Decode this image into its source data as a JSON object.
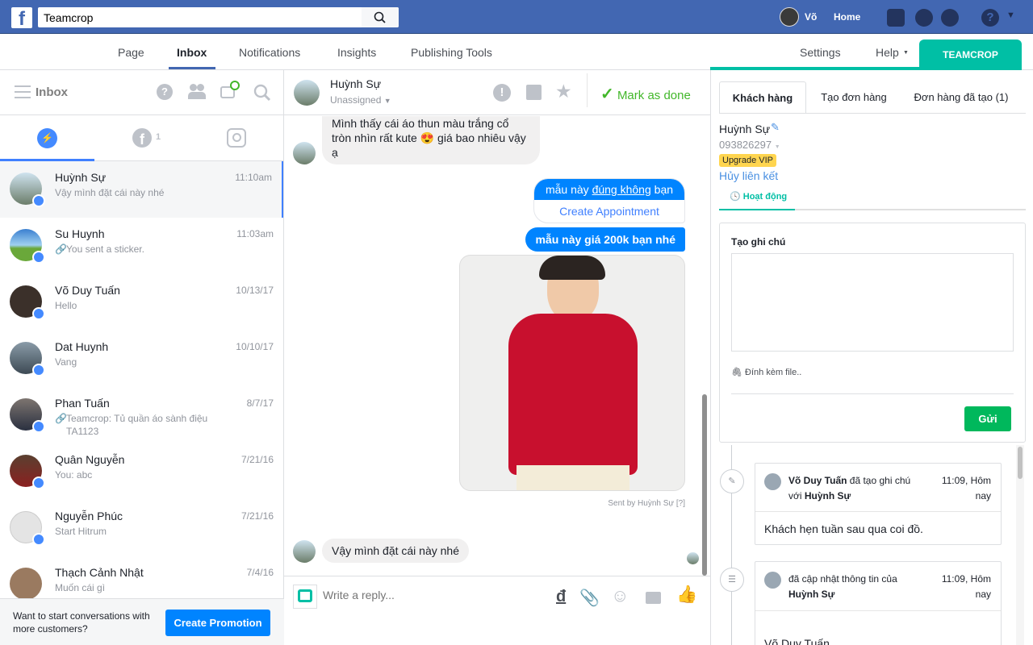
{
  "topbar": {
    "logo": "f",
    "search_value": "Teamcrop",
    "user_name": "Võ",
    "home": "Home"
  },
  "nav": {
    "items": [
      "Page",
      "Inbox",
      "Notifications",
      "Insights",
      "Publishing Tools"
    ],
    "active": "Inbox",
    "settings": "Settings",
    "help": "Help",
    "teamcrop": "TEAMCROP"
  },
  "inbox": {
    "title": "Inbox",
    "facebook_count": "1",
    "conversations": [
      {
        "name": "Huỳnh Sự",
        "time": "11:10am",
        "preview": "Vậy mình đặt cái này nhé",
        "selected": true
      },
      {
        "name": "Su Huynh",
        "time": "11:03am",
        "preview": "You sent a sticker.",
        "attachment": true
      },
      {
        "name": "Võ Duy Tuấn",
        "time": "10/13/17",
        "preview": "Hello"
      },
      {
        "name": "Dat Huynh",
        "time": "10/10/17",
        "preview": "Vang"
      },
      {
        "name": "Phan Tuấn",
        "time": "8/7/17",
        "preview": "Teamcrop: Tủ quần áo sành điệu TA1123",
        "attachment": true
      },
      {
        "name": "Quân Nguyễn",
        "time": "7/21/16",
        "preview": "You: abc"
      },
      {
        "name": "Nguyễn Phúc",
        "time": "7/21/16",
        "preview": "Start Hitrum"
      },
      {
        "name": "Thạch Cảnh Nhật",
        "time": "7/4/16",
        "preview": "Muốn cái gì"
      }
    ],
    "promo_text": "Want to start conversations with more customers?",
    "promo_button": "Create Promotion"
  },
  "chat": {
    "name": "Huỳnh Sự",
    "assignee": "Unassigned",
    "mark_done": "Mark as done",
    "messages": {
      "m1": "Mình thấy cái áo thun màu trắng cổ tròn nhìn rất kute 😍 giá bao nhiêu vậy ạ",
      "m2_pre": "mẫu này ",
      "m2_link": "đúng không",
      "m2_post": " bạn",
      "m2_action": "Create Appointment",
      "m3": "mẫu này giá 200k bạn nhé",
      "sent_by": "Sent by Huỳnh Sự",
      "sent_help": "[?]",
      "m4": "Vậy mình đặt cái này nhé"
    },
    "reply_placeholder": "Write a reply..."
  },
  "customer": {
    "tabs": [
      "Khách hàng",
      "Tạo đơn hàng",
      "Đơn hàng đã tạo (1)"
    ],
    "name": "Huỳnh Sự",
    "phone": "093826297",
    "vip": "Upgrade VIP",
    "unlink": "Hủy liên kết",
    "activity_tab": "Hoạt động",
    "note_title": "Tạo ghi chú",
    "attach": "Đính kèm file..",
    "send": "Gửi",
    "timeline": [
      {
        "actor": "Võ Duy Tuấn",
        "action": " đã tạo ghi chú với ",
        "target": "Huỳnh Sự",
        "time": "11:09, Hôm nay",
        "body": "Khách hẹn tuần sau qua coi đồ."
      },
      {
        "action": "đã cập nhật thông tin của ",
        "target": "Huỳnh Sự",
        "time": "11:09, Hôm nay",
        "body": "Võ Duy Tuấn"
      }
    ]
  },
  "colors": {
    "facebook_blue": "#4267b2",
    "messenger_blue": "#0084ff",
    "teal": "#00bfa5",
    "green": "#00b85c",
    "done_green": "#42b72a",
    "vip": "#ffd54f"
  }
}
